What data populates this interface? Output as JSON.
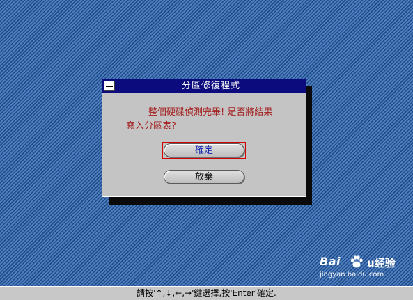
{
  "dialog": {
    "title": "分區修復程式",
    "message_line1": "整個硬碟偵測完畢! 是否將結果",
    "message_line2": "寫入分區表?",
    "buttons": {
      "confirm_label": "確定",
      "cancel_label": "放棄"
    }
  },
  "statusbar": {
    "hint": "請按'↑,↓,←,→'鍵選擇,按'Enter'確定."
  },
  "watermark": {
    "logo": "Bai",
    "logo_suffix": "u",
    "brand": "经验",
    "url": "jingyan.baidu.com"
  },
  "colors": {
    "desktop": "#2a5b9c",
    "titlebar": "#0b0b7e",
    "dialog_bg": "#c4c4c4",
    "message_text": "#a31e1e",
    "focus_ring": "#d20000",
    "confirm_text": "#1a2bb0"
  },
  "icons": {
    "system_menu": "system-menu-icon",
    "watermark_paw": "paw-icon"
  }
}
